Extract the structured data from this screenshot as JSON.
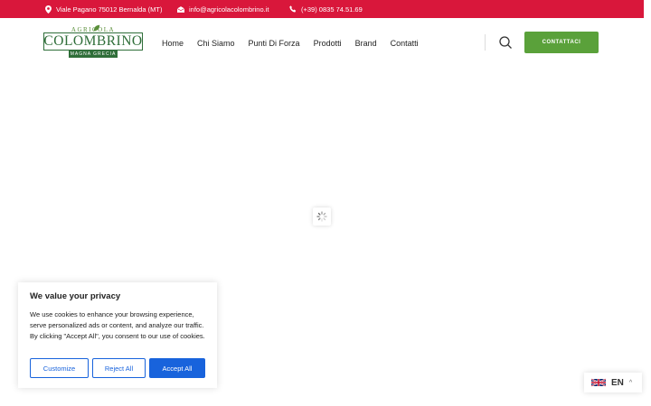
{
  "topbar": {
    "address": "Viale Pagano 75012 Bernalda (MT)",
    "email": "info@agricolacolombrino.it",
    "phone": "(+39) 0835 74.51.69"
  },
  "logo": {
    "tagline": "AGRICOLA",
    "name": "COLOMBRINO",
    "subtitle": "MAGNA GRECIA"
  },
  "nav": {
    "items": [
      "Home",
      "Chi Siamo",
      "Punti Di Forza",
      "Prodotti",
      "Brand",
      "Contatti"
    ]
  },
  "header": {
    "cta_label": "CONTATTACI"
  },
  "cookie": {
    "title": "We value your privacy",
    "text": "We use cookies to enhance your browsing experience, serve personalized ads or content, and analyze our traffic. By clicking \"Accept All\", you consent to our use of cookies.",
    "customize_label": "Customize",
    "reject_label": "Reject All",
    "accept_label": "Accept All"
  },
  "language": {
    "code": "EN",
    "flag_icon": "uk-flag-icon"
  },
  "colors": {
    "topbar": "#d9173b",
    "cta": "#5aa13a",
    "cookie_accent": "#1863dc",
    "logo": "#2f6e39"
  }
}
